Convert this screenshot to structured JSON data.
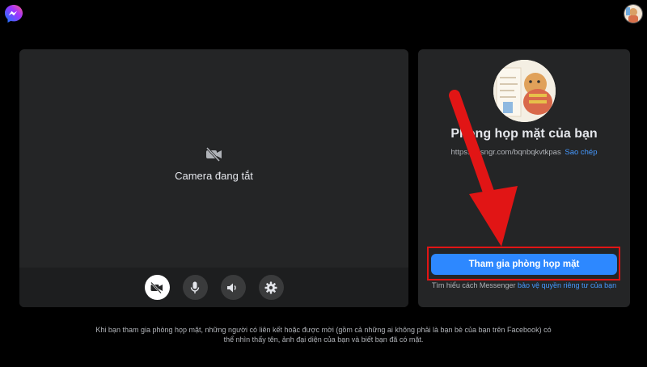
{
  "header": {
    "logo_icon": "messenger-logo-icon",
    "profile_icon": "profile-avatar-icon"
  },
  "video": {
    "camera_status": "Camera đang tắt",
    "controls": [
      {
        "name": "camera-off-icon",
        "active": true
      },
      {
        "name": "microphone-icon",
        "active": false
      },
      {
        "name": "speaker-icon",
        "active": false
      },
      {
        "name": "settings-gear-icon",
        "active": false
      }
    ]
  },
  "room": {
    "title": "Phòng họp mặt của bạn",
    "link": "https://msngr.com/bqnbqkvtkpas",
    "copy_label": "Sao chép",
    "join_label": "Tham gia phòng họp mặt",
    "privacy_prefix": "Tìm hiểu cách Messenger",
    "privacy_link": "bảo vệ quyền riêng tư của bạn"
  },
  "disclaimer": {
    "line1": "Khi bạn tham gia phòng họp mặt, những người có liên kết hoặc được mời (gồm cả những ai không phải là bạn bè của bạn trên Facebook) có",
    "line2": "thể nhìn thấy tên, ảnh đại diện của bạn và biết bạn đã có mặt."
  },
  "colors": {
    "accent": "#2d88ff",
    "highlight": "#e11515",
    "panel": "#242526",
    "background": "#000000"
  }
}
